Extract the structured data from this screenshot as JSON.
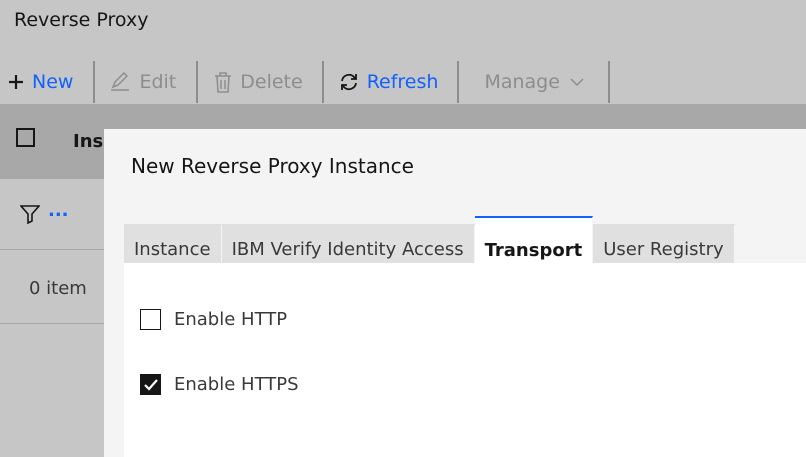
{
  "page": {
    "title": "Reverse Proxy"
  },
  "toolbar": {
    "new_label": "New",
    "edit_label": "Edit",
    "delete_label": "Delete",
    "refresh_label": "Refresh",
    "manage_label": "Manage"
  },
  "table": {
    "header_partial": "Ins",
    "filter_more": "...",
    "item_count": "0 item"
  },
  "modal": {
    "title": "New Reverse Proxy Instance",
    "tabs": [
      {
        "label": "Instance",
        "active": false
      },
      {
        "label": "IBM Verify Identity Access",
        "active": false
      },
      {
        "label": "Transport",
        "active": true
      },
      {
        "label": "User Registry",
        "active": false
      }
    ],
    "options": [
      {
        "label": "Enable HTTP",
        "checked": false
      },
      {
        "label": "Enable HTTPS",
        "checked": true
      }
    ]
  },
  "colors": {
    "accent": "#0f62fe",
    "disabled": "#8d8d8d"
  }
}
